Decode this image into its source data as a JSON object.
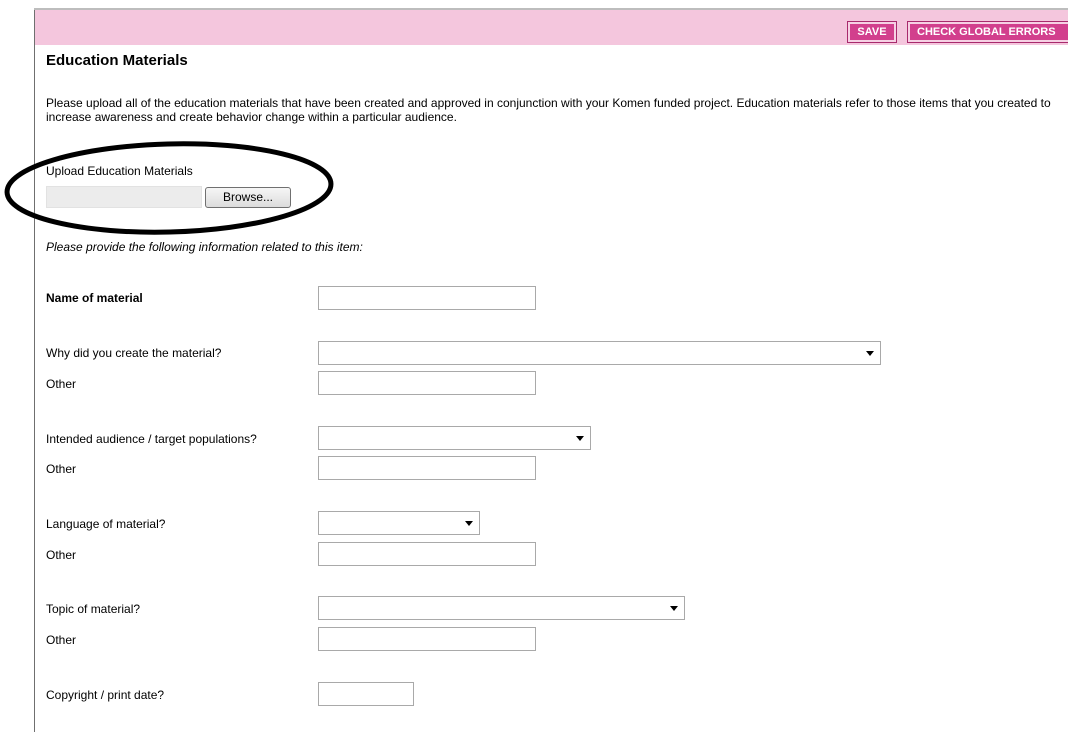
{
  "toolbar": {
    "save_label": "SAVE",
    "check_errors_label": "CHECK GLOBAL ERRORS"
  },
  "page": {
    "title": "Education Materials",
    "intro": "Please upload all of the education materials that have been created and approved in conjunction with your Komen funded project. Education materials refer to those items that you created to increase awareness and create behavior change within a particular audience."
  },
  "upload": {
    "label": "Upload Education Materials",
    "file_value": "",
    "browse_label": "Browse..."
  },
  "form": {
    "instruction": "Please provide the following information related to this item:",
    "name": {
      "label": "Name of material",
      "value": ""
    },
    "why": {
      "label": "Why did you create the material?",
      "selected": ""
    },
    "why_other": {
      "label": "Other",
      "value": ""
    },
    "audience": {
      "label": "Intended audience / target populations?",
      "selected": ""
    },
    "audience_other": {
      "label": "Other",
      "value": ""
    },
    "language": {
      "label": "Language of material?",
      "selected": ""
    },
    "language_other": {
      "label": "Other",
      "value": ""
    },
    "topic": {
      "label": "Topic of material?",
      "selected": ""
    },
    "topic_other": {
      "label": "Other",
      "value": ""
    },
    "copyright": {
      "label": "Copyright / print date?",
      "value": ""
    }
  },
  "colors": {
    "header_bg": "#f4c6dd",
    "button_bg": "#d23f8d",
    "annotation": "#000000"
  },
  "icons": {
    "dropdown": "chevron-down-icon"
  }
}
